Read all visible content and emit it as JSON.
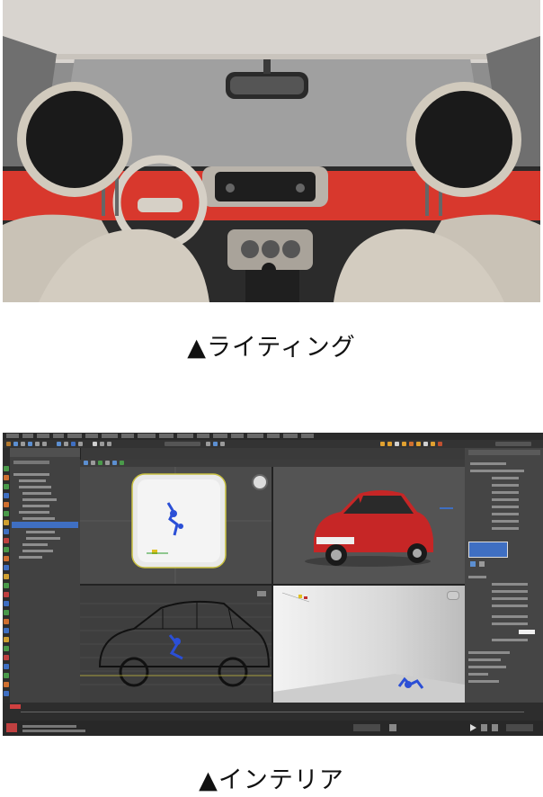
{
  "captions": {
    "lighting": "▲ライティング",
    "interior": "▲インテリア"
  },
  "colors": {
    "dashboard_red": "#d8382d",
    "seat_beige": "#c9c2b6",
    "app_background": "#3a3a3a",
    "selection_blue": "#3f6fc2",
    "car_red": "#c62626"
  },
  "icons": {
    "viewcube": "viewcube-icon",
    "play": "play-icon",
    "key": "key-icon"
  }
}
